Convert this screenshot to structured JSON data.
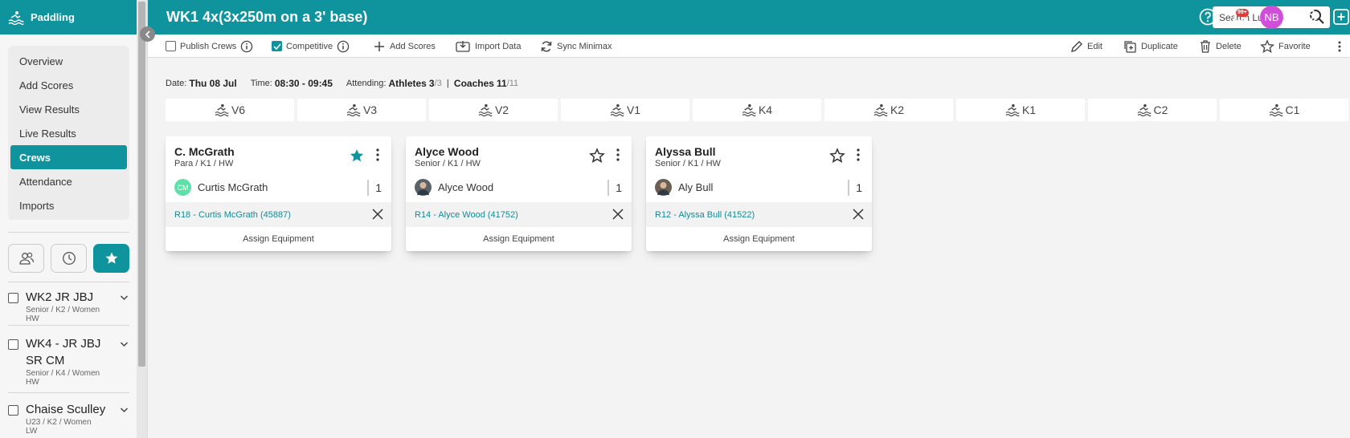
{
  "sidebar": {
    "title": "Paddling",
    "menu": [
      {
        "label": "Overview",
        "active": false
      },
      {
        "label": "Add Scores",
        "active": false
      },
      {
        "label": "View Results",
        "active": false
      },
      {
        "label": "Live Results",
        "active": false
      },
      {
        "label": "Crews",
        "active": true
      },
      {
        "label": "Attendance",
        "active": false
      },
      {
        "label": "Imports",
        "active": false
      }
    ],
    "view_buttons": [
      "people-icon",
      "clock-icon",
      "star-icon"
    ],
    "crew_list": [
      {
        "name": "WK2 JR JBJ",
        "sub1": "Senior / K2 / Women",
        "sub2": "HW"
      },
      {
        "name": "WK4 - JR JBJ",
        "name2": "SR CM",
        "sub1": "Senior / K4 / Women",
        "sub2": "HW"
      },
      {
        "name": "Chaise Sculley",
        "sub1": "U23 / K2 / Women",
        "sub2": "LW"
      }
    ]
  },
  "header": {
    "title": "WK1 4x(3x250m on a 3' base)",
    "search_placeholder": "Search Ludum",
    "notification_badge": "99+",
    "avatar_initials": "NB",
    "avatar_color": "#d04fd8",
    "accent_color": "#0f939c"
  },
  "toolbar": {
    "publish_label": "Publish Crews",
    "publish_checked": false,
    "competitive_label": "Competitive",
    "competitive_checked": true,
    "add_scores": "Add Scores",
    "import_data": "Import Data",
    "sync": "Sync Minimax",
    "edit": "Edit",
    "duplicate": "Duplicate",
    "delete": "Delete",
    "favorite": "Favorite"
  },
  "info": {
    "date_label": "Date:",
    "date": "Thu 08 Jul",
    "time_label": "Time:",
    "time": "08:30 - 09:45",
    "attending_label": "Attending:",
    "athletes_label": "Athletes",
    "athletes_count": "3",
    "athletes_total": "/3",
    "separator": "|",
    "coaches_label": "Coaches",
    "coaches_count": "11",
    "coaches_total": "/11"
  },
  "boat_tabs": [
    "V6",
    "V3",
    "V2",
    "V1",
    "K4",
    "K2",
    "K1",
    "C2",
    "C1"
  ],
  "crews": [
    {
      "title": "C. McGrath",
      "sub": "Para / K1 / HW",
      "favorite": true,
      "athlete": "Curtis McGrath",
      "initials": "CM",
      "avatar_color": "#5fe0a8",
      "seat": "1",
      "equipment": "R18 - Curtis McGrath (45887)",
      "assign": "Assign Equipment"
    },
    {
      "title": "Alyce Wood",
      "sub": "Senior / K1 / HW",
      "favorite": false,
      "athlete": "Alyce Wood",
      "initials": "",
      "avatar_color": "#5b6168",
      "seat": "1",
      "equipment": "R14 - Alyce Wood (41752)",
      "assign": "Assign Equipment"
    },
    {
      "title": "Alyssa Bull",
      "sub": "Senior / K1 / HW",
      "favorite": false,
      "athlete": "Aly Bull",
      "initials": "",
      "avatar_color": "#6b5e52",
      "seat": "1",
      "equipment": "R12 - Alyssa Bull (41522)",
      "assign": "Assign Equipment"
    }
  ]
}
